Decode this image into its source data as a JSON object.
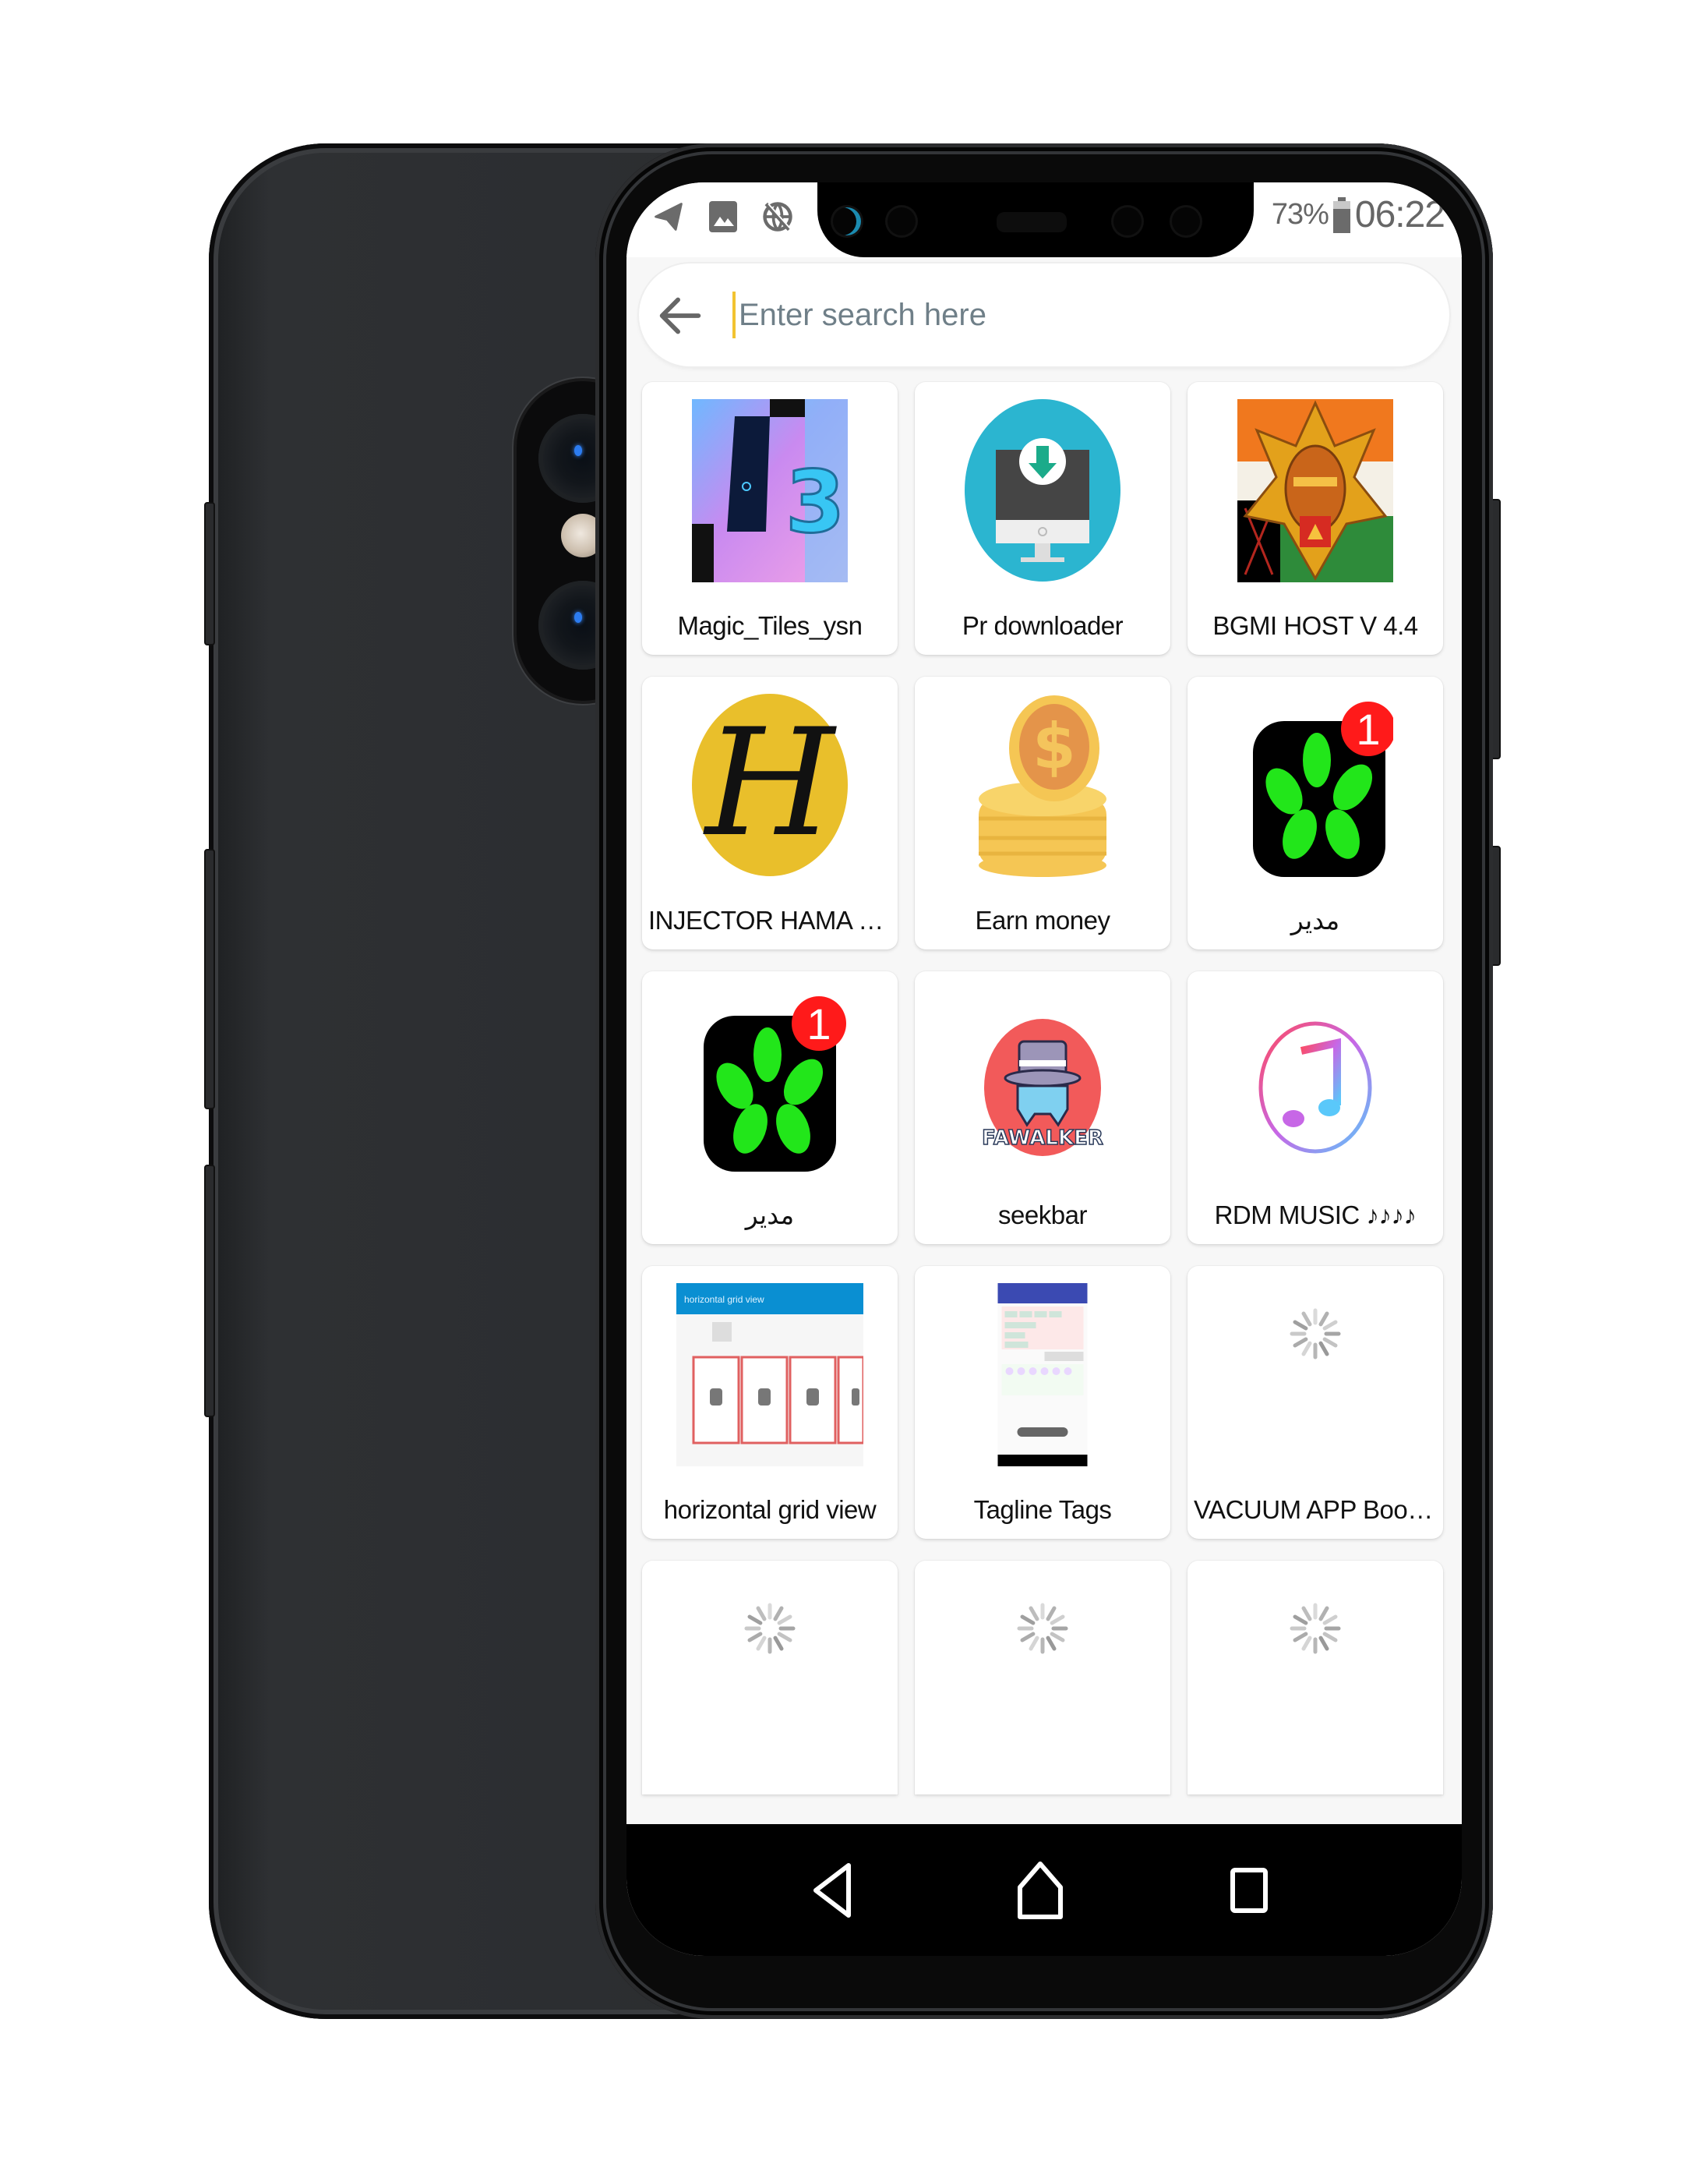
{
  "status_bar": {
    "left_icons": [
      "telegram-icon",
      "image-icon",
      "no-internet-icon"
    ],
    "battery_percent": "73%",
    "time": "06:22"
  },
  "search": {
    "placeholder": "Enter search here",
    "value": "",
    "back_icon": "arrow-left-icon"
  },
  "apps": [
    {
      "label": "Magic_Tiles_ysn",
      "icon": "magic-tiles-icon",
      "state": "loaded"
    },
    {
      "label": "Pr downloader",
      "icon": "download-monitor-icon",
      "state": "loaded"
    },
    {
      "label": "BGMI HOST V 4.4",
      "icon": "bgmi-icon",
      "state": "loaded"
    },
    {
      "label": "INJECTOR HAMA HA...",
      "icon": "letter-h-icon",
      "state": "loaded"
    },
    {
      "label": "Earn money",
      "icon": "coins-icon",
      "state": "loaded"
    },
    {
      "label": "مدير",
      "icon": "icq-flower-icon",
      "state": "loaded",
      "badge": "1"
    },
    {
      "label": "مدير",
      "icon": "icq-flower-icon",
      "state": "loaded",
      "badge": "1"
    },
    {
      "label": "seekbar",
      "icon": "fawalker-icon",
      "state": "loaded",
      "icon_text": "FAWALKER"
    },
    {
      "label": "RDM MUSIC ♪♪♪♪",
      "icon": "music-note-icon",
      "state": "loaded"
    },
    {
      "label": "horizontal grid view",
      "icon": "grid-view-screenshot-icon",
      "state": "loaded",
      "icon_text": "horizontal grid view"
    },
    {
      "label": "Tagline Tags",
      "icon": "tagline-screenshot-icon",
      "state": "loaded"
    },
    {
      "label": "VACUUM APP Booster",
      "icon": "loading-spinner-icon",
      "state": "loading"
    },
    {
      "label": "",
      "icon": "loading-spinner-icon",
      "state": "loading"
    },
    {
      "label": "",
      "icon": "loading-spinner-icon",
      "state": "loading"
    },
    {
      "label": "",
      "icon": "loading-spinner-icon",
      "state": "loading"
    }
  ],
  "nav_bar": {
    "back": "back-triangle-icon",
    "home": "home-icon",
    "recents": "recents-square-icon"
  },
  "colors": {
    "search_cursor": "#f2c331",
    "badge": "#ff1a1a",
    "icq_green": "#22e61a",
    "pr_teal": "#2bb5d0",
    "h_yellow": "#e9bf2b"
  }
}
